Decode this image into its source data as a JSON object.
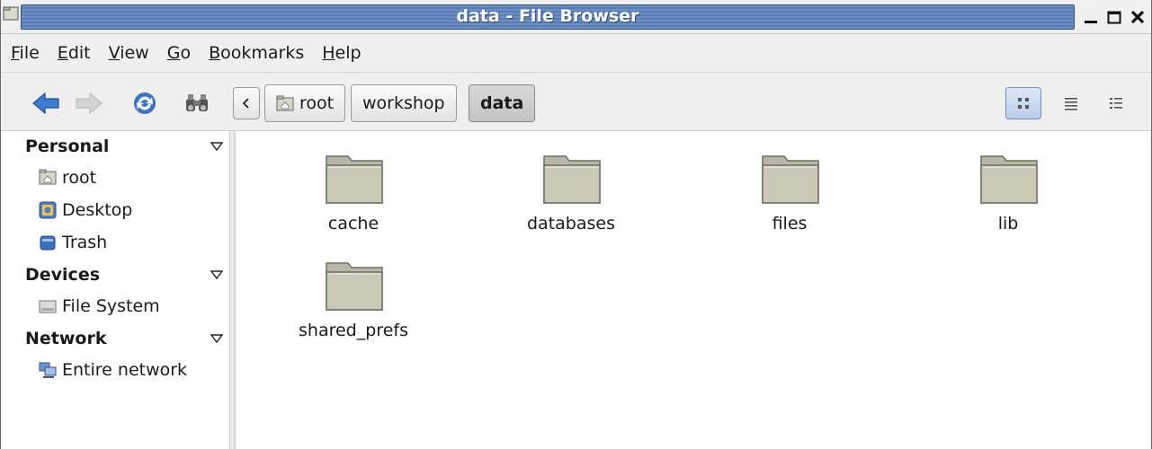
{
  "window": {
    "title": "data - File Browser"
  },
  "menu": [
    {
      "pre": "",
      "ul": "F",
      "post": "ile"
    },
    {
      "pre": "",
      "ul": "E",
      "post": "dit"
    },
    {
      "pre": "",
      "ul": "V",
      "post": "iew"
    },
    {
      "pre": "",
      "ul": "G",
      "post": "o"
    },
    {
      "pre": "",
      "ul": "B",
      "post": "ookmarks"
    },
    {
      "pre": "",
      "ul": "H",
      "post": "elp"
    }
  ],
  "breadcrumbs": [
    "root",
    "workshop",
    "data"
  ],
  "sidebar": {
    "sections": [
      {
        "label": "Personal",
        "items": [
          {
            "label": "root",
            "icon": "home-folder-icon"
          },
          {
            "label": "Desktop",
            "icon": "desktop-icon"
          },
          {
            "label": "Trash",
            "icon": "trash-icon"
          }
        ]
      },
      {
        "label": "Devices",
        "items": [
          {
            "label": "File System",
            "icon": "drive-icon"
          }
        ]
      },
      {
        "label": "Network",
        "items": [
          {
            "label": "Entire network",
            "icon": "network-icon"
          }
        ]
      }
    ]
  },
  "files": [
    "cache",
    "databases",
    "files",
    "lib",
    "shared_prefs"
  ],
  "colors": {
    "title_bar": "#587cb3",
    "folder_fill": "#c9c9b8",
    "view_active": "#b9cdea"
  }
}
